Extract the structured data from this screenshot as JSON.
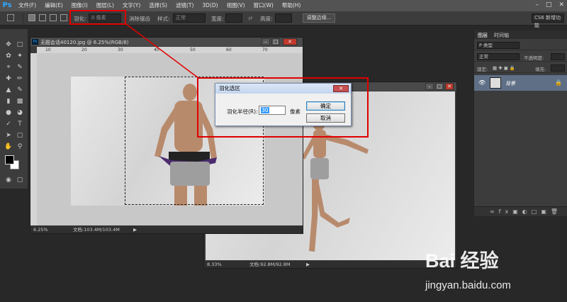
{
  "app": {
    "logo": "Ps"
  },
  "menu": [
    "文件(F)",
    "编辑(E)",
    "图像(I)",
    "图层(L)",
    "文字(Y)",
    "选择(S)",
    "滤镜(T)",
    "3D(D)",
    "视图(V)",
    "窗口(W)",
    "帮助(H)"
  ],
  "options_bar": {
    "feather_label": "羽化:",
    "feather_value": "0 像素",
    "anti_alias_label": "消除锯齿",
    "style_label": "样式:",
    "style_value": "正常",
    "width_label": "宽度:",
    "height_label": "高度:",
    "refine_edge_button": "调整边缘...",
    "workspace": "CS6 新增功能"
  },
  "doc1": {
    "title": "无题会话40120.jpg @ 6.25%(RGB/8)",
    "ruler_ticks": [
      "10",
      "20",
      "30",
      "40",
      "50",
      "60",
      "70"
    ],
    "zoom": "6.25%",
    "doc_size": "文档:103.4M/103.4M"
  },
  "doc2": {
    "zoom": "8.33%",
    "doc_size": "文档:92.8M/92.8M"
  },
  "dialog": {
    "title": "羽化选区",
    "radius_label": "羽化半径(R):",
    "radius_value": "30",
    "unit": "像素",
    "ok": "确定",
    "cancel": "取消"
  },
  "layers_panel": {
    "tabs": [
      "图层",
      "时间轴"
    ],
    "filter": "P 类型",
    "blend_mode": "正常",
    "opacity_label": "不透明度:",
    "lock_label": "锁定:",
    "fill_label": "填充:",
    "layer_name": "背景"
  },
  "watermark": {
    "brand": "Bai 经验",
    "url": "jingyan.baidu.com"
  },
  "colors": {
    "highlight": "#e00000",
    "menu_bg": "#535353",
    "panel_bg": "#3c3c3c",
    "workspace_bg": "#282828",
    "selected_layer": "#5f6f86"
  }
}
